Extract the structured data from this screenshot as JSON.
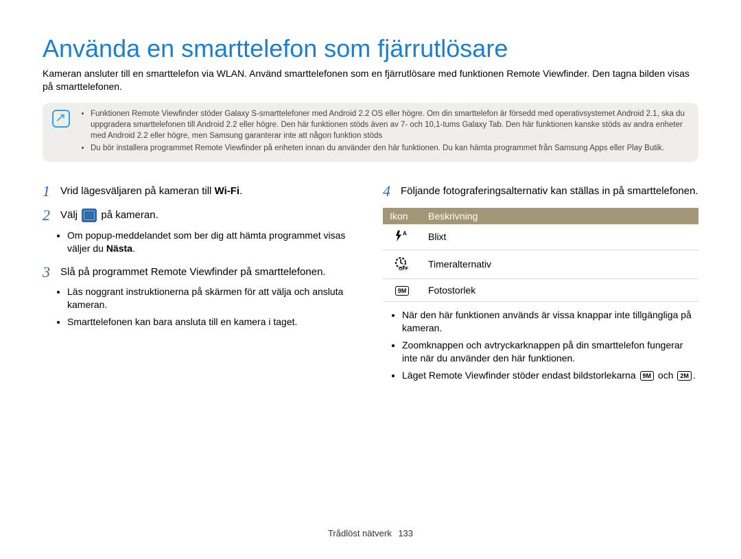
{
  "title": "Använda en smarttelefon som fjärrutlösare",
  "intro": "Kameran ansluter till en smarttelefon via WLAN. Använd smarttelefonen som en fjärrutlösare med funktionen Remote Viewfinder. Den tagna bilden visas på smarttelefonen.",
  "note": {
    "items": [
      "Funktionen Remote Viewfinder stöder Galaxy S-smarttelefoner med Android 2.2 OS eller högre. Om din smarttelefon är försedd med operativsystemet Android 2.1, ska du uppgradera smarttelefonen till Android 2.2 eller högre. Den här funktionen stöds även av 7- och 10,1-tums Galaxy Tab. Den här funktionen kanske stöds av andra enheter med Android 2.2 eller högre, men Samsung garanterar inte att någon funktion stöds",
      "Du bör installera programmet Remote Viewfinder på enheten innan du använder den här funktionen. Du kan hämta programmet från Samsung Apps eller Play Butik."
    ]
  },
  "left": {
    "s1_pre": "Vrid lägesväljaren på kameran till ",
    "s1_wifi": "Wi-Fi",
    "s2_pre": "Välj ",
    "s2_post": " på kameran.",
    "s2_bul_pre": "Om popup-meddelandet som ber dig att hämta programmet visas väljer du ",
    "s2_bul_bold": "Nästa",
    "s3": "Slå på programmet Remote Viewfinder på smarttelefonen.",
    "s3_bul1": "Läs noggrant instruktionerna på skärmen för att välja och ansluta kameran.",
    "s3_bul2": "Smarttelefonen kan bara ansluta till en kamera i taget."
  },
  "right": {
    "s4": "Följande fotograferingsalternativ kan ställas in på smarttelefonen.",
    "table": {
      "h1": "Ikon",
      "h2": "Beskrivning",
      "r1": "Blixt",
      "r2": "Timeralternativ",
      "r3": "Fotostorlek"
    },
    "bul1": "När den här funktionen används är vissa knappar inte tillgängliga på kameran.",
    "bul2": "Zoomknappen och avtryckarknappen på din smarttelefon fungerar inte när du använder den här funktionen.",
    "bul3_pre": "Läget Remote Viewfinder stöder endast bildstorlekarna ",
    "bul3_mid": " och ",
    "size9m": "9M",
    "size2m": "2M"
  },
  "footer": {
    "section": "Trådlöst nätverk",
    "page": "133"
  }
}
